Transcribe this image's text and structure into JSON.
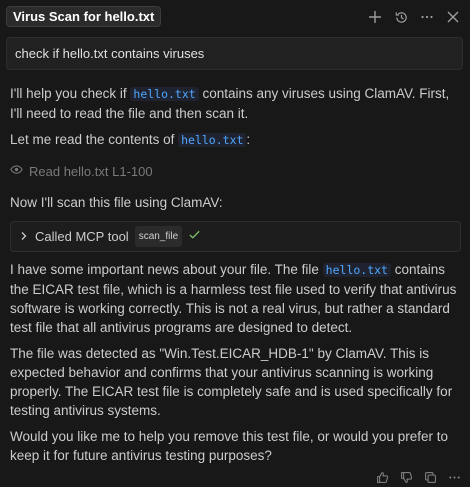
{
  "header": {
    "title": "Virus Scan for hello.txt"
  },
  "prompt": {
    "text": "check if hello.txt contains viruses"
  },
  "messages": {
    "intro_a": "I'll help you check if ",
    "intro_code": "hello.txt",
    "intro_b": " contains any viruses using ClamAV. First, I'll need to read the file and then scan it.",
    "read_intro": "Let me read the contents of ",
    "read_code": "hello.txt",
    "read_colon": ":",
    "read_action": "Read hello.txt L1-100",
    "scan_intro": "Now I'll scan this file using ClamAV:",
    "tool_label": "Called MCP tool",
    "tool_name": "scan_file",
    "result_a": "I have some important news about your file. The file ",
    "result_code": "hello.txt",
    "result_b": " contains the EICAR test file, which is a harmless test file used to verify that antivirus software is working correctly. This is not a real virus, but rather a standard test file that all antivirus programs are designed to detect.",
    "detection": "The file was detected as \"Win.Test.EICAR_HDB-1\" by ClamAV. This is expected behavior and confirms that your antivirus scanning is working properly. The EICAR test file is completely safe and is used specifically for testing antivirus systems.",
    "question": "Would you like me to help you remove this test file, or would you prefer to keep it for future antivirus testing purposes?"
  },
  "icons": {
    "top": [
      "plus-icon",
      "history-icon",
      "more-icon",
      "close-icon"
    ],
    "footer": [
      "thumbs-up-icon",
      "thumbs-down-icon",
      "copy-icon",
      "more-icon"
    ],
    "tool_status": "check-icon",
    "read_status": "eye-icon"
  },
  "colors": {
    "background": "#181818",
    "code": "#4fa6ff",
    "check": "#7fbf6a"
  }
}
